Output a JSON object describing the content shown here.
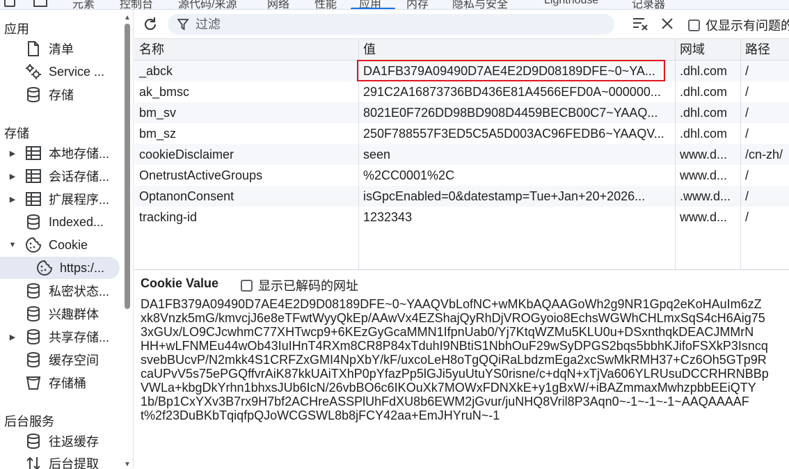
{
  "top_tabs": [
    "元素",
    "控制台",
    "源代码/来源",
    "网络",
    "性能",
    "应用",
    "内存",
    "隐私与安全",
    "Lighthouse",
    "记录器"
  ],
  "toolbar": {
    "filter_placeholder": "过滤",
    "only_issues_label": "仅显示有问题的"
  },
  "sidebar": {
    "section_app": "应用",
    "app_items": [
      "清单",
      "Service ...",
      "存储"
    ],
    "section_storage": "存储",
    "storage_items": [
      "本地存储...",
      "会话存储...",
      "扩展程序...",
      "Indexed...",
      "Cookie",
      "https:/...",
      "私密状态...",
      "兴趣群体",
      "共享存储...",
      "缓存空间",
      "存储桶"
    ],
    "section_background": "后台服务",
    "background_items": [
      "往返缓存",
      "后台提取"
    ]
  },
  "table": {
    "headers": [
      "名称",
      "值",
      "网域",
      "路径"
    ],
    "rows": [
      {
        "name": "_abck",
        "value": "DA1FB379A09490D7AE4E2D9D08189DFE~0~YA...",
        "domain": ".dhl.com",
        "path": "/"
      },
      {
        "name": "ak_bmsc",
        "value": "291C2A16873736BD436E81A4566EFD0A~000000...",
        "domain": ".dhl.com",
        "path": "/"
      },
      {
        "name": "bm_sv",
        "value": "8021E0F726DD98BD908D4459BECB00C7~YAAQ...",
        "domain": ".dhl.com",
        "path": "/"
      },
      {
        "name": "bm_sz",
        "value": "250F788557F3ED5C5A5D003AC96FEDB6~YAAQV...",
        "domain": ".dhl.com",
        "path": "/"
      },
      {
        "name": "cookieDisclaimer",
        "value": "seen",
        "domain": "www.d...",
        "path": "/cn-zh/"
      },
      {
        "name": "OnetrustActiveGroups",
        "value": "%2CC0001%2C",
        "domain": "www.d...",
        "path": "/"
      },
      {
        "name": "OptanonConsent",
        "value": "isGpcEnabled=0&datestamp=Tue+Jan+20+2026...",
        "domain": ".www.d...",
        "path": "/"
      },
      {
        "name": "tracking-id",
        "value": "1232343",
        "domain": "www.d...",
        "path": "/"
      }
    ]
  },
  "cookie_value": {
    "title": "Cookie Value",
    "decode_label": "显示已解码的网址",
    "lines": [
      "DA1FB379A09490D7AE4E2D9D08189DFE~0~YAAQVbLofNC+wMKbAQAAGoWh2g9NR1Gpq2eKoHAuIm6zZ",
      "xk8Vnzk5mG/kmvcjJ6e8eTFwtWyyQkEp/AAwVx4EZShajQyRhDjVROGyoio8EchsWGWhCHLmxSqS4cH6Aig75",
      "3xGUx/LO9CJcwhmC77XHTwcp9+6KEzGyGcaMMN1IfpnUab0/Yj7KtqWZMu5KLU0u+DSxnthqkDEACJMMrN",
      "HH+wLFNMEu44wOb43IuIHnT4RXm8CR8P84xTduhI9NBtiS1NbhOuF29wSyDPGS2bqs5bbhKJifoFSXkP3Isncq",
      "svebBUcvP/N2mkk4S1CRFZxGMI4NpXbY/kF/uxcoLeH8oTgQQiRaLbdzmEga2xcSwMkRMH37+Cz6Oh5GTp9R",
      "caUPvV5s75ePGQffvrAiK87kkUAiTXhP0pYfazPp5lGJi5yuUtuYS0risne/c+dqN+xTjVa606YLRUsuDCCRHRNBBp",
      "VWLa+kbgDkYrhn1bhxsJUb6IcN/26vbBO6c6IKOuXk7MOWxFDNXkE+y1gBxW/+iBAZmmaxMwhzpbbEEiQTY",
      "1b/Bp1CxYXv3B7rx9H7bf2ACHreASSPlUhFdXU8b6EWM2jGvur/juNHQ8Vril8P3Aqn0~-1~-1~-1~AAQAAAAF",
      "t%2f23DuBKbTqiqfpQJoWCGSWL8b8jFCY42aa+EmJHYruN~-1"
    ]
  },
  "colors": {
    "highlight": "#e0161f",
    "accent": "#1a73e8"
  }
}
